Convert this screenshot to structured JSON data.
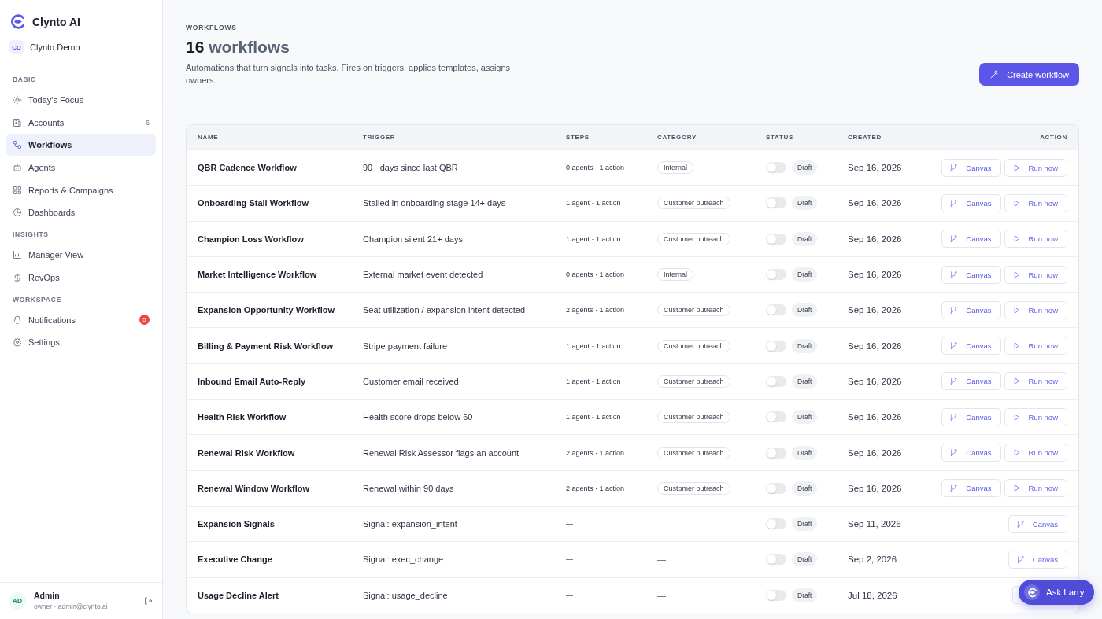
{
  "sidebar": {
    "brand": "Clynto AI",
    "workspace": {
      "initials": "CD",
      "name": "Clynto Demo"
    },
    "sections": [
      {
        "heading": "BASIC",
        "items": [
          {
            "kind": "sun",
            "label": "Today's Focus",
            "selected": false
          },
          {
            "kind": "building",
            "label": "Accounts",
            "count": "6",
            "selected": false
          },
          {
            "kind": "flow",
            "label": "Workflows",
            "selected": true
          },
          {
            "kind": "robot",
            "label": "Agents",
            "selected": false
          },
          {
            "kind": "grid",
            "label": "Reports & Campaigns",
            "selected": false
          },
          {
            "kind": "pie",
            "label": "Dashboards",
            "selected": false
          }
        ]
      },
      {
        "heading": "INSIGHTS",
        "items": [
          {
            "kind": "bars",
            "label": "Manager View",
            "selected": false
          },
          {
            "kind": "dollar",
            "label": "RevOps",
            "selected": false
          }
        ]
      },
      {
        "heading": "WORKSPACE",
        "items": [
          {
            "kind": "bell",
            "label": "Notifications",
            "badge": "5",
            "selected": false
          },
          {
            "kind": "gear",
            "label": "Settings",
            "selected": false
          }
        ]
      }
    ],
    "user": {
      "initials": "AD",
      "name": "Admin",
      "detail": "owner · admin@clynto.ai"
    }
  },
  "header": {
    "eyebrow": "WORKFLOWS",
    "count": "16",
    "title": "workflows",
    "description": "Automations that turn signals into tasks. Fires on triggers, applies templates, assigns owners.",
    "button": "Create workflow"
  },
  "table": {
    "columns": [
      "NAME",
      "TRIGGER",
      "STEPS",
      "CATEGORY",
      "STATUS",
      "CREATED",
      "ACTION"
    ],
    "rows": [
      {
        "name": "QBR Cadence Workflow",
        "trigger": "90+ days since last QBR",
        "steps": "0 agents · 1 action",
        "category": "Internal",
        "on": false,
        "status": "Draft",
        "created": "Sep 16, 2026",
        "actions": [
          {
            "kind": "canvas",
            "label": "Canvas"
          },
          {
            "kind": "run",
            "label": "Run now"
          }
        ]
      },
      {
        "name": "Onboarding Stall Workflow",
        "trigger": "Stalled in onboarding stage 14+ days",
        "steps": "1 agent · 1 action",
        "category": "Customer outreach",
        "on": false,
        "status": "Draft",
        "created": "Sep 16, 2026",
        "actions": [
          {
            "kind": "canvas",
            "label": "Canvas"
          },
          {
            "kind": "run",
            "label": "Run now"
          }
        ]
      },
      {
        "name": "Champion Loss Workflow",
        "trigger": "Champion silent 21+ days",
        "steps": "1 agent · 1 action",
        "category": "Customer outreach",
        "on": false,
        "status": "Draft",
        "created": "Sep 16, 2026",
        "actions": [
          {
            "kind": "canvas",
            "label": "Canvas"
          },
          {
            "kind": "run",
            "label": "Run now"
          }
        ]
      },
      {
        "name": "Market Intelligence Workflow",
        "trigger": "External market event detected",
        "steps": "0 agents · 1 action",
        "category": "Internal",
        "on": false,
        "status": "Draft",
        "created": "Sep 16, 2026",
        "actions": [
          {
            "kind": "canvas",
            "label": "Canvas"
          },
          {
            "kind": "run",
            "label": "Run now"
          }
        ]
      },
      {
        "name": "Expansion Opportunity Workflow",
        "trigger": "Seat utilization / expansion intent detected",
        "steps": "2 agents · 1 action",
        "category": "Customer outreach",
        "on": false,
        "status": "Draft",
        "created": "Sep 16, 2026",
        "actions": [
          {
            "kind": "canvas",
            "label": "Canvas"
          },
          {
            "kind": "run",
            "label": "Run now"
          }
        ]
      },
      {
        "name": "Billing & Payment Risk Workflow",
        "trigger": "Stripe payment failure",
        "steps": "1 agent · 1 action",
        "category": "Customer outreach",
        "on": false,
        "status": "Draft",
        "created": "Sep 16, 2026",
        "actions": [
          {
            "kind": "canvas",
            "label": "Canvas"
          },
          {
            "kind": "run",
            "label": "Run now"
          }
        ]
      },
      {
        "name": "Inbound Email Auto-Reply",
        "trigger": "Customer email received",
        "steps": "1 agent · 1 action",
        "category": "Customer outreach",
        "on": false,
        "status": "Draft",
        "created": "Sep 16, 2026",
        "actions": [
          {
            "kind": "canvas",
            "label": "Canvas"
          },
          {
            "kind": "run",
            "label": "Run now"
          }
        ]
      },
      {
        "name": "Health Risk Workflow",
        "trigger": "Health score drops below 60",
        "steps": "1 agent · 1 action",
        "category": "Customer outreach",
        "on": false,
        "status": "Draft",
        "created": "Sep 16, 2026",
        "actions": [
          {
            "kind": "canvas",
            "label": "Canvas"
          },
          {
            "kind": "run",
            "label": "Run now"
          }
        ]
      },
      {
        "name": "Renewal Risk Workflow",
        "trigger": "Renewal Risk Assessor flags an account",
        "steps": "2 agents · 1 action",
        "category": "Customer outreach",
        "on": false,
        "status": "Draft",
        "created": "Sep 16, 2026",
        "actions": [
          {
            "kind": "canvas",
            "label": "Canvas"
          },
          {
            "kind": "run",
            "label": "Run now"
          }
        ]
      },
      {
        "name": "Renewal Window Workflow",
        "trigger": "Renewal within 90 days",
        "steps": "2 agents · 1 action",
        "category": "Customer outreach",
        "on": false,
        "status": "Draft",
        "created": "Sep 16, 2026",
        "actions": [
          {
            "kind": "canvas",
            "label": "Canvas"
          },
          {
            "kind": "run",
            "label": "Run now"
          }
        ]
      },
      {
        "name": "Expansion Signals",
        "trigger": "Signal: expansion_intent",
        "steps": "—",
        "category_text": "—",
        "on": false,
        "status": "Draft",
        "created": "Sep 11, 2026",
        "actions": [
          {
            "kind": "canvas",
            "label": "Canvas"
          }
        ]
      },
      {
        "name": "Executive Change",
        "trigger": "Signal: exec_change",
        "steps": "—",
        "category_text": "—",
        "on": false,
        "status": "Draft",
        "created": "Sep 2, 2026",
        "actions": [
          {
            "kind": "canvas",
            "label": "Canvas"
          }
        ]
      },
      {
        "name": "Usage Decline Alert",
        "trigger": "Signal: usage_decline",
        "steps": "—",
        "category_text": "—",
        "on": false,
        "status": "Draft",
        "created": "Jul 18, 2026",
        "actions": [
          {
            "kind": "canvas"
          }
        ]
      }
    ]
  },
  "assistant": {
    "label": "Ask Larry"
  }
}
